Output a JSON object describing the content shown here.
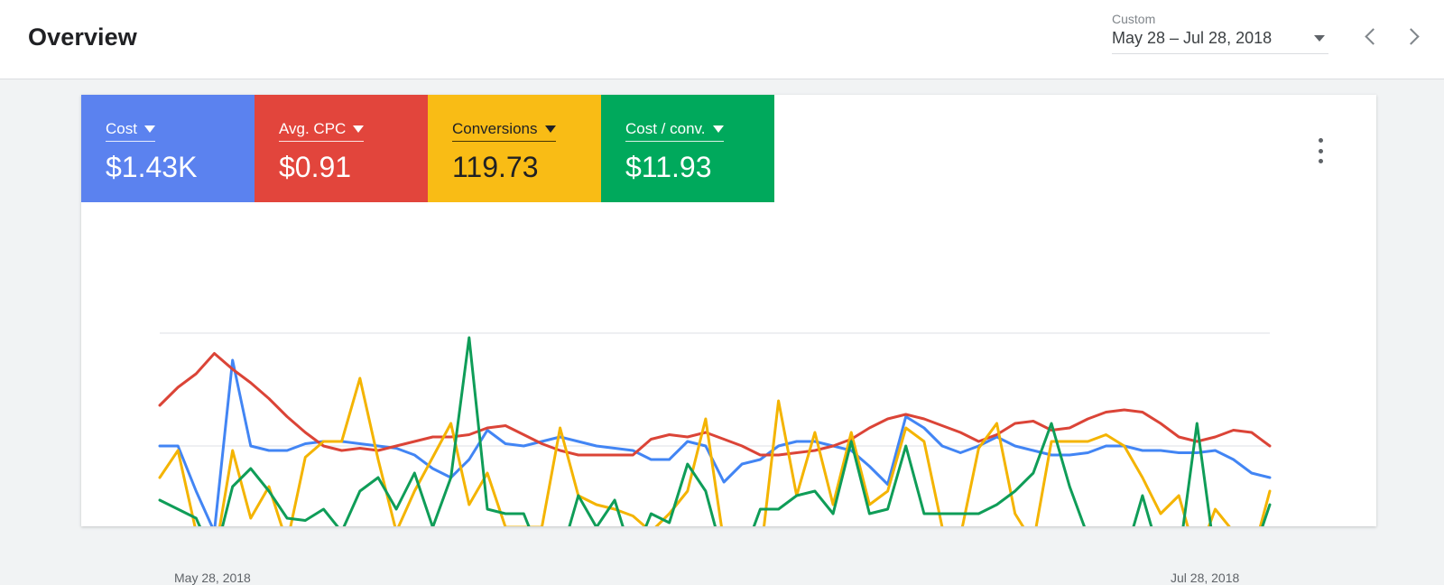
{
  "header": {
    "title": "Overview",
    "daterange": {
      "label": "Custom",
      "value": "May 28 – Jul 28, 2018",
      "dropdown_icon": "caret-down-icon",
      "prev_icon": "chevron-left-icon",
      "next_icon": "chevron-right-icon"
    }
  },
  "card": {
    "menu_icon": "more-vert-icon",
    "tiles": [
      {
        "label": "Cost",
        "value": "$1.43K",
        "color": "#5b82ef",
        "text_color": "#ffffff",
        "caret_icon": "caret-down-icon"
      },
      {
        "label": "Avg. CPC",
        "value": "$0.91",
        "color": "#e2453c",
        "text_color": "#ffffff",
        "caret_icon": "caret-down-icon"
      },
      {
        "label": "Conversions",
        "value": "119.73",
        "color": "#f9bc15",
        "text_color": "#202124",
        "caret_icon": "caret-down-icon"
      },
      {
        "label": "Cost / conv.",
        "value": "$11.93",
        "color": "#00a95c",
        "text_color": "#ffffff",
        "caret_icon": "caret-down-icon"
      }
    ]
  },
  "chart_data": {
    "type": "line",
    "title": "",
    "xlabel": "",
    "ylabel": "",
    "grid": true,
    "gridlines": [
      100,
      50,
      0
    ],
    "legend_position": "none",
    "x_tick_labels": [
      "May 28, 2018",
      "Jul 28, 2018"
    ],
    "x": [
      "May 28, 2018",
      "May 29, 2018",
      "May 30, 2018",
      "May 31, 2018",
      "Jun 1, 2018",
      "Jun 2, 2018",
      "Jun 3, 2018",
      "Jun 4, 2018",
      "Jun 5, 2018",
      "Jun 6, 2018",
      "Jun 7, 2018",
      "Jun 8, 2018",
      "Jun 9, 2018",
      "Jun 10, 2018",
      "Jun 11, 2018",
      "Jun 12, 2018",
      "Jun 13, 2018",
      "Jun 14, 2018",
      "Jun 15, 2018",
      "Jun 16, 2018",
      "Jun 17, 2018",
      "Jun 18, 2018",
      "Jun 19, 2018",
      "Jun 20, 2018",
      "Jun 21, 2018",
      "Jun 22, 2018",
      "Jun 23, 2018",
      "Jun 24, 2018",
      "Jun 25, 2018",
      "Jun 26, 2018",
      "Jun 27, 2018",
      "Jun 28, 2018",
      "Jun 29, 2018",
      "Jun 30, 2018",
      "Jul 1, 2018",
      "Jul 2, 2018",
      "Jul 3, 2018",
      "Jul 4, 2018",
      "Jul 5, 2018",
      "Jul 6, 2018",
      "Jul 7, 2018",
      "Jul 8, 2018",
      "Jul 9, 2018",
      "Jul 10, 2018",
      "Jul 11, 2018",
      "Jul 12, 2018",
      "Jul 13, 2018",
      "Jul 14, 2018",
      "Jul 15, 2018",
      "Jul 16, 2018",
      "Jul 17, 2018",
      "Jul 18, 2018",
      "Jul 19, 2018",
      "Jul 20, 2018",
      "Jul 21, 2018",
      "Jul 22, 2018",
      "Jul 23, 2018",
      "Jul 24, 2018",
      "Jul 25, 2018",
      "Jul 26, 2018",
      "Jul 27, 2018",
      "Jul 28, 2018"
    ],
    "ylim": [
      0,
      100
    ],
    "series": [
      {
        "name": "Cost",
        "color": "#4285f4",
        "values": [
          50,
          50,
          30,
          12,
          88,
          50,
          48,
          48,
          51,
          52,
          52,
          51,
          50,
          49,
          46,
          40,
          36,
          44,
          57,
          51,
          50,
          52,
          54,
          52,
          50,
          49,
          48,
          44,
          44,
          52,
          50,
          34,
          42,
          44,
          50,
          52,
          52,
          50,
          48,
          41,
          33,
          63,
          58,
          50,
          47,
          50,
          54,
          50,
          48,
          46,
          46,
          47,
          50,
          50,
          48,
          48,
          47,
          47,
          48,
          44,
          38,
          36
        ]
      },
      {
        "name": "Avg. CPC",
        "color": "#db4437",
        "values": [
          68,
          76,
          82,
          91,
          84,
          78,
          71,
          63,
          56,
          50,
          48,
          49,
          48,
          50,
          52,
          54,
          54,
          55,
          58,
          59,
          55,
          51,
          48,
          46,
          46,
          46,
          46,
          53,
          55,
          54,
          56,
          53,
          50,
          46,
          46,
          47,
          48,
          50,
          53,
          58,
          62,
          64,
          62,
          59,
          56,
          52,
          55,
          60,
          61,
          57,
          58,
          62,
          65,
          66,
          65,
          60,
          54,
          52,
          54,
          57,
          56,
          50
        ]
      },
      {
        "name": "Conversions",
        "color": "#f4b400",
        "values": [
          36,
          48,
          12,
          0,
          48,
          18,
          32,
          7,
          45,
          52,
          52,
          80,
          44,
          12,
          30,
          45,
          60,
          24,
          38,
          14,
          14,
          14,
          58,
          28,
          24,
          22,
          19,
          12,
          20,
          30,
          62,
          7,
          0,
          0,
          70,
          28,
          56,
          24,
          56,
          24,
          30,
          58,
          52,
          14,
          10,
          49,
          60,
          20,
          7,
          52,
          52,
          52,
          55,
          50,
          36,
          20,
          28,
          0,
          22,
          12,
          0,
          30
        ]
      },
      {
        "name": "Cost / conv.",
        "color": "#0f9d58",
        "values": [
          26,
          22,
          18,
          0,
          32,
          40,
          30,
          18,
          17,
          22,
          12,
          30,
          36,
          22,
          38,
          14,
          36,
          98,
          22,
          20,
          20,
          0,
          0,
          28,
          14,
          26,
          0,
          20,
          16,
          42,
          30,
          0,
          0,
          22,
          22,
          28,
          30,
          20,
          52,
          20,
          22,
          50,
          20,
          20,
          20,
          20,
          24,
          30,
          38,
          60,
          32,
          10,
          0,
          0,
          28,
          0,
          0,
          60,
          0,
          0,
          0,
          24
        ]
      }
    ]
  }
}
